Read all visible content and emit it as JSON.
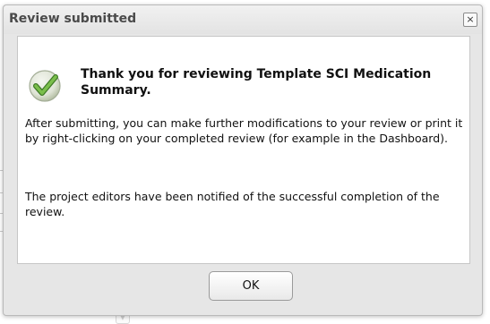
{
  "dialog": {
    "title": "Review submitted",
    "close_icon": "close-icon",
    "close_glyph": "×",
    "headline": "Thank you for reviewing Template SCI Medication Summary.",
    "paragraph1": "After submitting, you can make further modifications to your review or print it by right-clicking on your completed review (for example in the Dashboard).",
    "paragraph2": "The project editors have been notified of the successful completion of the review.",
    "status_icon": "checkmark-icon",
    "ok_label": "OK"
  },
  "colors": {
    "title_text": "#4a4a4a",
    "check_green": "#6aa843",
    "check_dark": "#3e7a25",
    "dialog_bg": "#e6e6e6",
    "content_bg": "#ffffff"
  }
}
